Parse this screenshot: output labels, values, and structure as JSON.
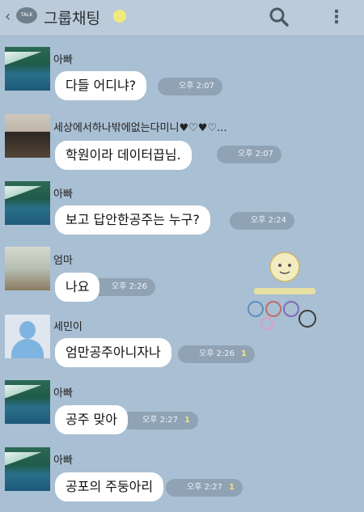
{
  "header": {
    "back_icon": "back-arrow-icon",
    "chat_badge": "TALK",
    "title": "그룹채팅",
    "emoji": "smile-icon",
    "search_icon": "search-icon",
    "more_icon": "more-vertical-icon"
  },
  "messages": [
    {
      "sender": "아빠",
      "text": "다들 어디냐?",
      "time": "오후 2:07",
      "unread": ""
    },
    {
      "sender": "세상에서하나밖에없는다미니♥♡♥♡...",
      "text": "학원이라 데이터끕님.",
      "time": "오후 2:07",
      "unread": ""
    },
    {
      "sender": "아빠",
      "text": "보고 답안한공주는 누구?",
      "time": "오후 2:24",
      "unread": ""
    },
    {
      "sender": "엄마",
      "text": "나요",
      "time": "오후 2:26",
      "unread": ""
    },
    {
      "sender": "세민이",
      "text": "엄만공주아니자나",
      "time": "오후 2:26",
      "unread": "1"
    },
    {
      "sender": "아빠",
      "text": "공주 맞아",
      "time": "오후 2:27",
      "unread": "1"
    },
    {
      "sender": "아빠",
      "text": "공포의 주둥아리",
      "time": "오후 2:27",
      "unread": "1"
    }
  ],
  "colors": {
    "background": "#a9bfd3",
    "header": "#bccbd9",
    "bubble": "#ffffff",
    "meta_pill": "#8fa3b5"
  }
}
